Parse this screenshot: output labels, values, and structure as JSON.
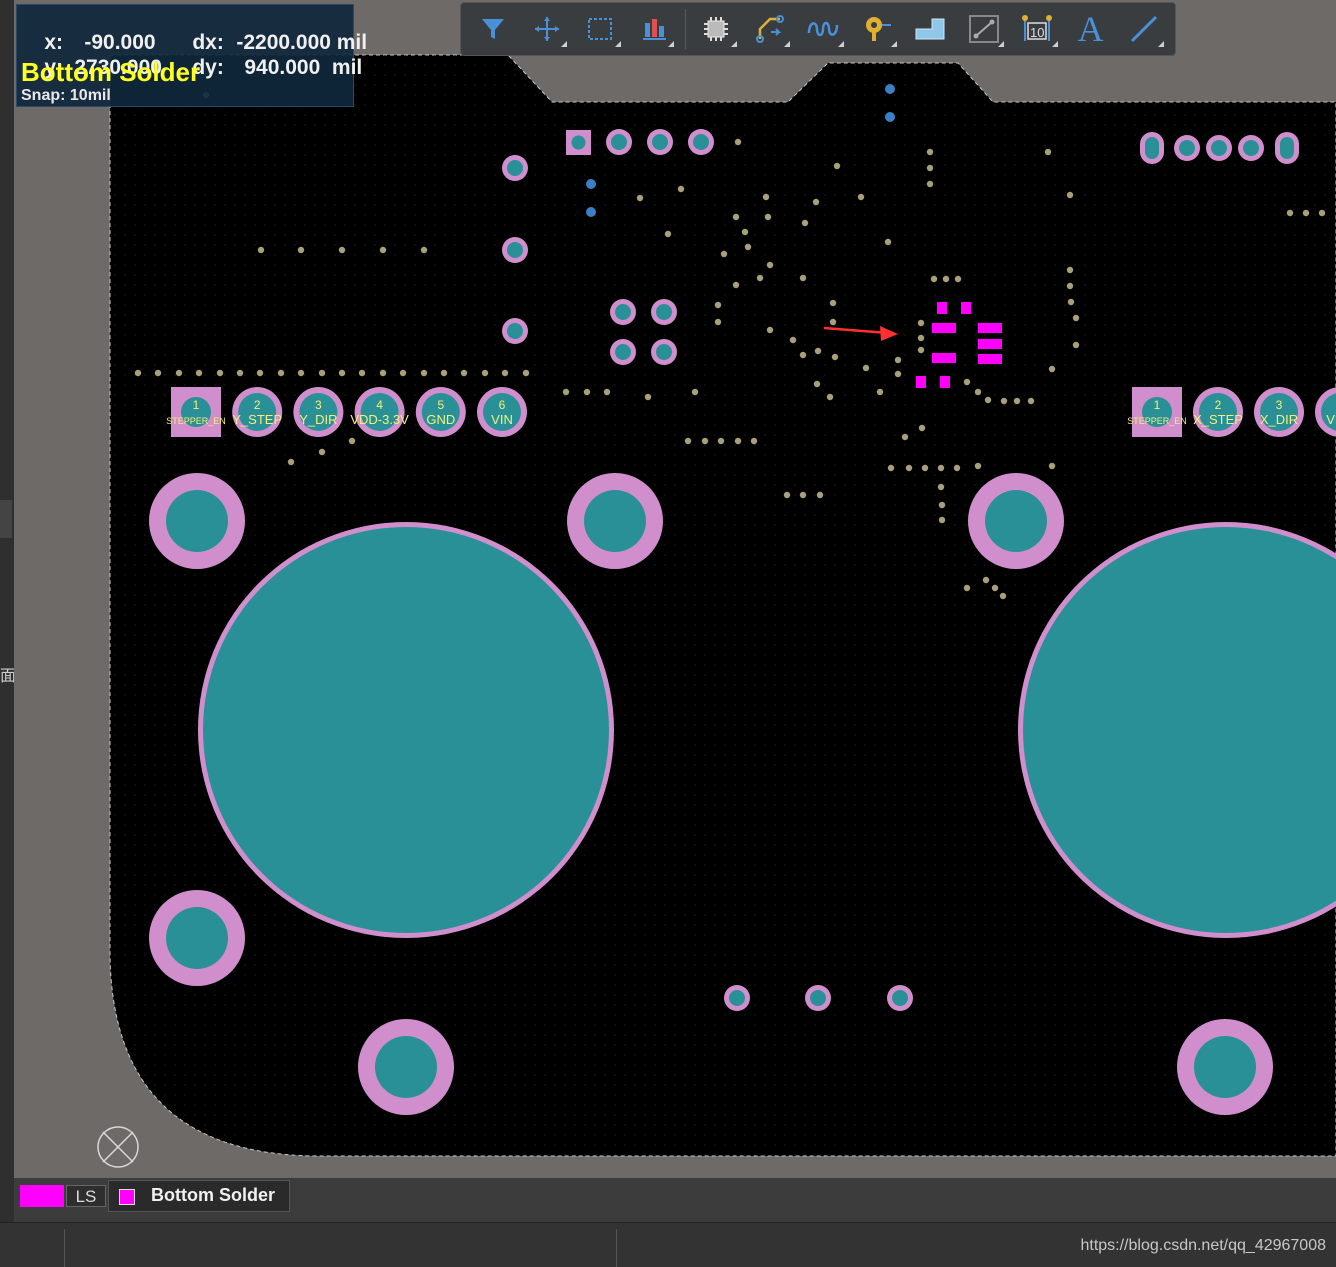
{
  "hud": {
    "x_label": "x:",
    "x_value": "-90.000",
    "dx_label": "dx:",
    "dx_value": "-2200.000 mil",
    "y_label": "y:",
    "y_value": "2730.000",
    "dy_label": "dy:",
    "dy_value": "940.000  mil",
    "layer": "Bottom Solder",
    "snap": "Snap: 10mil"
  },
  "toolbar": {
    "tools": [
      {
        "name": "filter-icon"
      },
      {
        "name": "move-icon"
      },
      {
        "name": "select-rect-icon"
      },
      {
        "name": "align-icon"
      },
      {
        "name": "component-icon"
      },
      {
        "name": "route-icon"
      },
      {
        "name": "length-tune-icon"
      },
      {
        "name": "via-icon"
      },
      {
        "name": "polygon-icon"
      },
      {
        "name": "keepout-icon"
      },
      {
        "name": "dimension-icon"
      },
      {
        "name": "text-icon",
        "glyph": "A"
      },
      {
        "name": "line-icon"
      }
    ]
  },
  "pads": {
    "left_header": [
      {
        "num": "1",
        "net": "STEPPER_EN"
      },
      {
        "num": "2",
        "net": "Y_STEP"
      },
      {
        "num": "3",
        "net": "Y_DIR"
      },
      {
        "num": "4",
        "net": "VDD-3.3V"
      },
      {
        "num": "5",
        "net": "GND"
      },
      {
        "num": "6",
        "net": "VIN"
      }
    ],
    "right_header": [
      {
        "num": "1",
        "net": "STEPPER_EN"
      },
      {
        "num": "2",
        "net": "X_STEP"
      },
      {
        "num": "3",
        "net": "X_DIR"
      },
      {
        "num": "",
        "net": "VDD"
      }
    ]
  },
  "statusbar": {
    "ls_label": "LS",
    "layer_tab": "Bottom Solder"
  },
  "watermark": "https://blog.csdn.net/qq_42967008",
  "colors": {
    "board": "#000000",
    "outside": "#6e6a68",
    "pad_fill": "#2a9097",
    "solder_mask": "#d08ecc",
    "smd_pad": "#ff00ff",
    "small_via": "#a8a07c",
    "blue_via": "#3b7fc4",
    "arrow": "#ff3030"
  },
  "left_panel_glyph": "面"
}
